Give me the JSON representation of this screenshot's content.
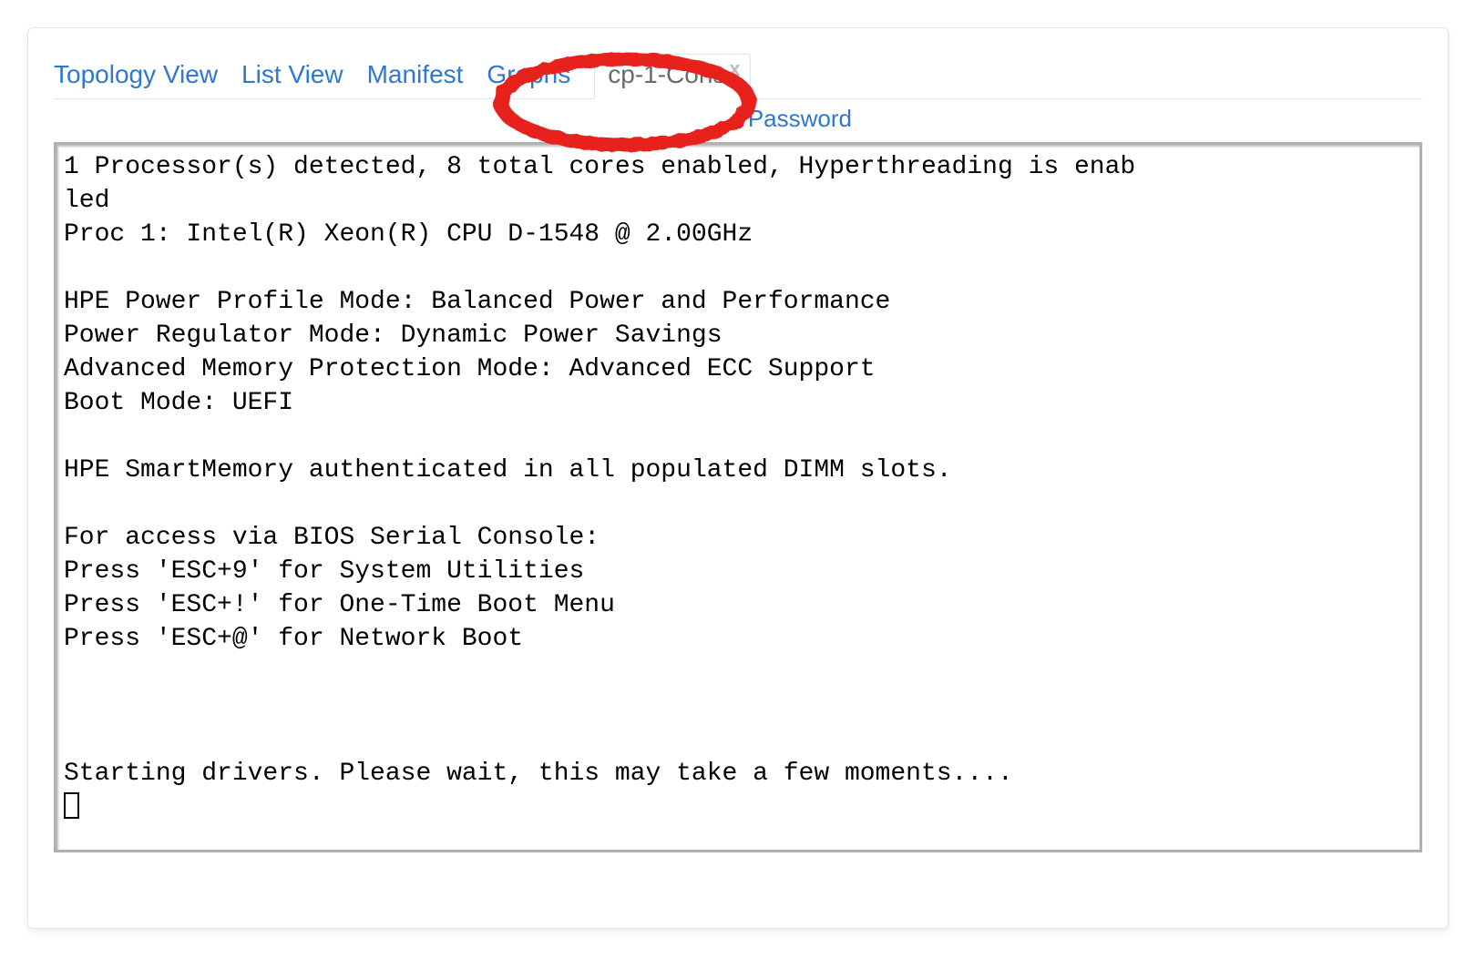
{
  "tabs": {
    "items": [
      {
        "label": "Topology View"
      },
      {
        "label": "List View"
      },
      {
        "label": "Manifest"
      },
      {
        "label": "Graphs"
      }
    ],
    "active": {
      "label": "cp-1-Cons",
      "close_glyph": "x"
    }
  },
  "subrow": {
    "password_label": "Password"
  },
  "console": {
    "lines": [
      "1 Processor(s) detected, 8 total cores enabled, Hyperthreading is enab",
      "led",
      "Proc 1: Intel(R) Xeon(R) CPU D-1548 @ 2.00GHz",
      "",
      "HPE Power Profile Mode: Balanced Power and Performance",
      "Power Regulator Mode: Dynamic Power Savings",
      "Advanced Memory Protection Mode: Advanced ECC Support",
      "Boot Mode: UEFI",
      "",
      "HPE SmartMemory authenticated in all populated DIMM slots.",
      "",
      "For access via BIOS Serial Console:",
      "Press 'ESC+9' for System Utilities",
      "Press 'ESC+!' for One-Time Boot Menu",
      "Press 'ESC+@' for Network Boot",
      "",
      "",
      "",
      "Starting drivers. Please wait, this may take a few moments...."
    ]
  }
}
